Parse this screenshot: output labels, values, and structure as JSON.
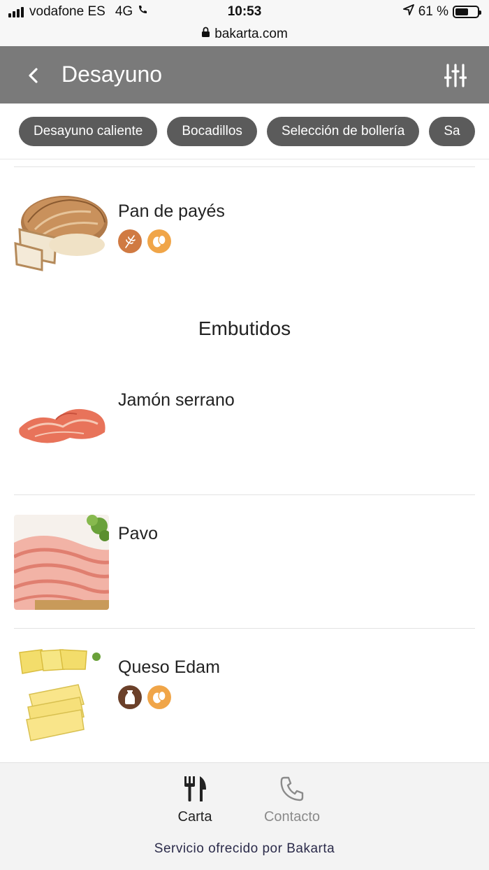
{
  "status_bar": {
    "carrier": "vodafone ES",
    "network": "4G",
    "time": "10:53",
    "battery_percent": "61 %",
    "battery_level": 0.61
  },
  "url_bar": {
    "domain": "bakarta.com"
  },
  "header": {
    "title": "Desayuno"
  },
  "chips": [
    "Desayuno caliente",
    "Bocadillos",
    "Selección de bollería",
    "Sa"
  ],
  "sections": {
    "embutidos_title": "Embutidos"
  },
  "items": {
    "pan": {
      "name": "Pan de payés",
      "allergens": [
        "gluten-icon",
        "egg-icon"
      ]
    },
    "jamon": {
      "name": "Jamón serrano"
    },
    "pavo": {
      "name": "Pavo"
    },
    "queso": {
      "name": "Queso Edam",
      "allergens": [
        "milk-icon",
        "egg-icon"
      ]
    }
  },
  "colors": {
    "header_bg": "#7a7a7a",
    "chip_bg": "#5b5b5b",
    "gluten_badge": "#d07a42",
    "egg_badge": "#f0a548",
    "milk_badge": "#6b4029"
  },
  "bottom_nav": {
    "carta_label": "Carta",
    "contacto_label": "Contacto"
  },
  "footer": {
    "text": "Servicio ofrecido por Bakarta"
  }
}
